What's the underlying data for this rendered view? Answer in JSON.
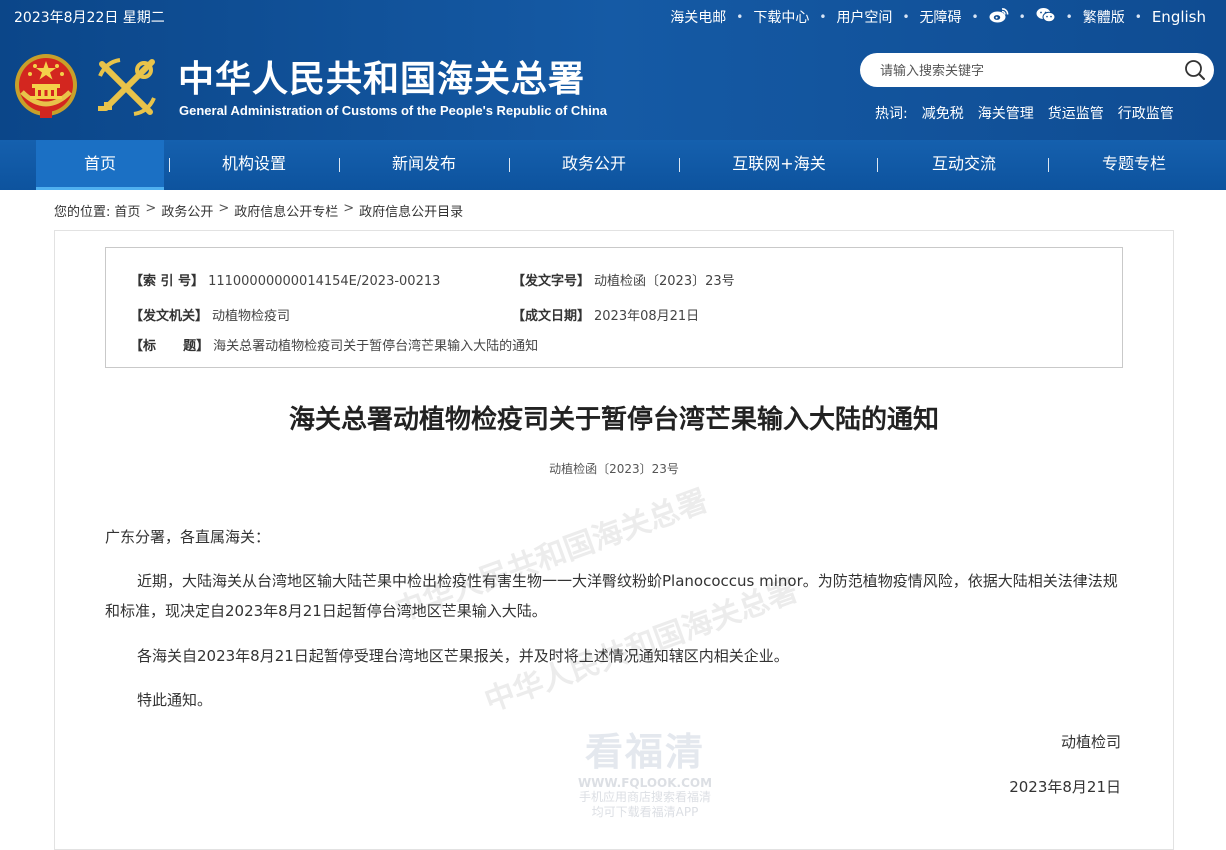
{
  "topbar": {
    "date": "2023年8月22日 星期二",
    "links": [
      {
        "label": "海关电邮",
        "name": "toplink-email"
      },
      {
        "label": "下载中心",
        "name": "toplink-download"
      },
      {
        "label": "用户空间",
        "name": "toplink-user-space"
      },
      {
        "label": "无障碍",
        "name": "toplink-accessibility"
      }
    ],
    "weibo_icon": "weibo-icon",
    "wechat_icon": "wechat-icon",
    "traditional_label": "繁體版",
    "english_label": "English"
  },
  "header": {
    "title": "中华人民共和国海关总署",
    "subtitle": "General Administration of Customs of the People's Republic of China",
    "emblem_icon": "national-emblem-icon",
    "logo_icon": "customs-logo-icon"
  },
  "search": {
    "placeholder": "请输入搜索关键字",
    "value": ""
  },
  "hot": {
    "label": "热词:",
    "words": [
      "减免税",
      "海关管理",
      "货运监管",
      "行政监管"
    ]
  },
  "nav": {
    "items": [
      {
        "label": "首页",
        "active": true
      },
      {
        "label": "机构设置",
        "active": false
      },
      {
        "label": "新闻发布",
        "active": false
      },
      {
        "label": "政务公开",
        "active": false
      },
      {
        "label": "互联网+海关",
        "active": false
      },
      {
        "label": "互动交流",
        "active": false
      },
      {
        "label": "专题专栏",
        "active": false
      }
    ]
  },
  "breadcrumb": {
    "prefix": "您的位置:",
    "items": [
      "首页",
      "政务公开",
      "政府信息公开专栏",
      "政府信息公开目录"
    ],
    "separator": ">"
  },
  "meta": {
    "index_label": "【索 引 号】",
    "index_value": "11100000000014154E/2023-00213",
    "docnum_label": "【发文字号】",
    "docnum_value": "动植检函〔2023〕23号",
    "issuer_label": "【发文机关】",
    "issuer_value": "动植物检疫司",
    "date_label": "【成文日期】",
    "date_value": "2023年08月21日",
    "title_label": "【标      题】",
    "title_value": "海关总署动植物检疫司关于暂停台湾芒果输入大陆的通知"
  },
  "document": {
    "title": "海关总署动植物检疫司关于暂停台湾芒果输入大陆的通知",
    "number": "动植检函〔2023〕23号",
    "salutation": "广东分署，各直属海关：",
    "paragraphs": [
      "近期，大陆海关从台湾地区输大陆芒果中检出检疫性有害生物一一大洋臀纹粉蚧Planococcus minor。为防范植物疫情风险，依据大陆相关法律法规和标准，现决定自2023年8月21日起暂停台湾地区芒果输入大陆。",
      "各海关自2023年8月21日起暂停受理台湾地区芒果报关，并及时将上述情况通知辖区内相关企业。",
      "特此通知。"
    ],
    "signature": "动植检司",
    "signature_date": "2023年8月21日"
  },
  "watermark": {
    "main": "看福清",
    "url": "WWW.FQLOOK.COM",
    "tip_line1": "手机应用商店搜索看福清",
    "tip_line2": "均可下载看福清APP"
  },
  "colors": {
    "header_blue": "#0e4b8f",
    "nav_blue": "#0f5aa7",
    "nav_active": "#1b70c4",
    "nav_active_underline": "#4fb0f0"
  }
}
